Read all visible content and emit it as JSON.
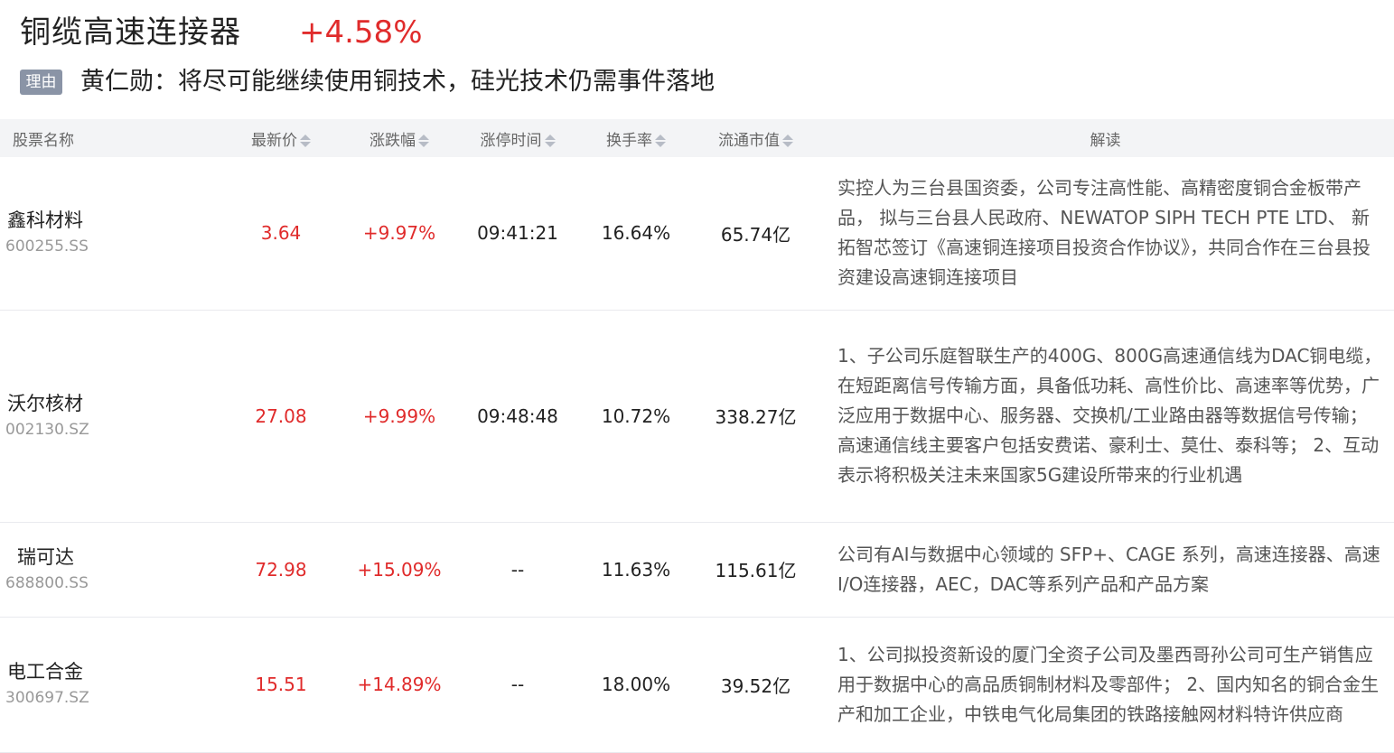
{
  "header": {
    "title": "铜缆高速连接器",
    "change": "+4.58%",
    "reason_tag": "理由",
    "reason": "黄仁勋：将尽可能继续使用铜技术，硅光技术仍需事件落地"
  },
  "table": {
    "columns": {
      "name": "股票名称",
      "price": "最新价",
      "change": "涨跌幅",
      "limit_time": "涨停时间",
      "turnover": "换手率",
      "market_cap": "流通市值",
      "interpretation": "解读"
    },
    "rows": [
      {
        "name": "鑫科材料",
        "code": "600255.SS",
        "price": "3.64",
        "change": "+9.97%",
        "limit_time": "09:41:21",
        "turnover": "16.64%",
        "market_cap": "65.74亿",
        "interpretation": "实控人为三台县国资委，公司专注高性能、高精密度铜合金板带产品， 拟与三台县人民政府、NEWATOP SIPH TECH PTE LTD、 新拓智芯签订《高速铜连接项目投资合作协议》，共同合作在三台县投资建设高速铜连接项目"
      },
      {
        "name": "沃尔核材",
        "code": "002130.SZ",
        "price": "27.08",
        "change": "+9.99%",
        "limit_time": "09:48:48",
        "turnover": "10.72%",
        "market_cap": "338.27亿",
        "interpretation": "1、子公司乐庭智联生产的400G、800G高速通信线为DAC铜电缆，在短距离信号传输方面，具备低功耗、高性价比、高速率等优势，广泛应用于数据中心、服务器、交换机/工业路由器等数据信号传输；高速通信线主要客户包括安费诺、豪利士、莫仕、泰科等； 2、互动表示将积极关注未来国家5G建设所带来的行业机遇"
      },
      {
        "name": "瑞可达",
        "code": "688800.SS",
        "price": "72.98",
        "change": "+15.09%",
        "limit_time": "--",
        "turnover": "11.63%",
        "market_cap": "115.61亿",
        "interpretation": "公司有AI与数据中心领域的 SFP+、CAGE 系列，高速连接器、高速I/O连接器，AEC，DAC等系列产品和产品方案"
      },
      {
        "name": "电工合金",
        "code": "300697.SZ",
        "price": "15.51",
        "change": "+14.89%",
        "limit_time": "--",
        "turnover": "18.00%",
        "market_cap": "39.52亿",
        "interpretation": "1、公司拟投资新设的厦门全资子公司及墨西哥孙公司可生产销售应用于数据中心的高品质铜制材料及零部件； 2、国内知名的铜合金生产和加工企业，中铁电气化局集团的铁路接触网材料特许供应商"
      }
    ]
  },
  "colors": {
    "up": "#e02b2b",
    "header_bg": "#f3f4f6",
    "tag_bg": "#8a94a6"
  }
}
